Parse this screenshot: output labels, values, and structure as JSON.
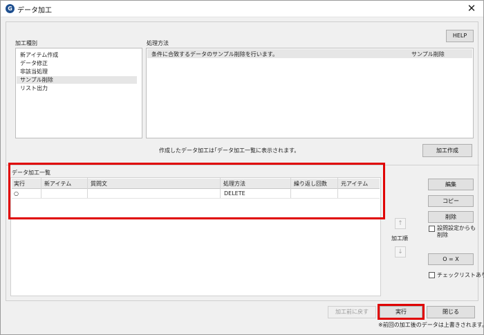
{
  "window": {
    "title": "データ加工",
    "app_icon": "G",
    "close_glyph": "✕"
  },
  "help_label": "HELP",
  "process_type": {
    "label": "加工種別",
    "items": [
      "新アイテム作成",
      "データ修正",
      "非該当処理",
      "サンプル削除",
      "リスト出力"
    ],
    "selected_index": 3
  },
  "method": {
    "label": "処理方法",
    "description": "条件に合致するデータのサンプル削除を行います。",
    "value": "サンプル削除"
  },
  "info_text": "作成したデータ加工は｢データ加工一覧に表示されます。",
  "create_button": "加工作成",
  "list": {
    "label": "データ加工一覧",
    "columns": [
      "実行",
      "新アイテム",
      "質問文",
      "処理方法",
      "繰り返し回数",
      "元アイテム"
    ],
    "rows": [
      {
        "run": "○",
        "new_item": "",
        "question": "",
        "method": "DELETE",
        "repeat": "",
        "source_item": ""
      }
    ]
  },
  "side": {
    "edit": "編集",
    "copy": "コピー",
    "delete": "削除",
    "delete_settings_check": "設問設定からも削除",
    "order_label": "加工順",
    "up_glyph": "↑",
    "down_glyph": "↓",
    "oex": "O = X",
    "checklist": "チェックリストあり"
  },
  "footer": {
    "undo": "加工前に戻す",
    "execute": "実行",
    "close": "閉じる",
    "note": "※前回の加工後のデータは上書きされます。"
  },
  "colors": {
    "highlight_red": "#e00000",
    "app_icon_blue": "#1e4f8f"
  }
}
